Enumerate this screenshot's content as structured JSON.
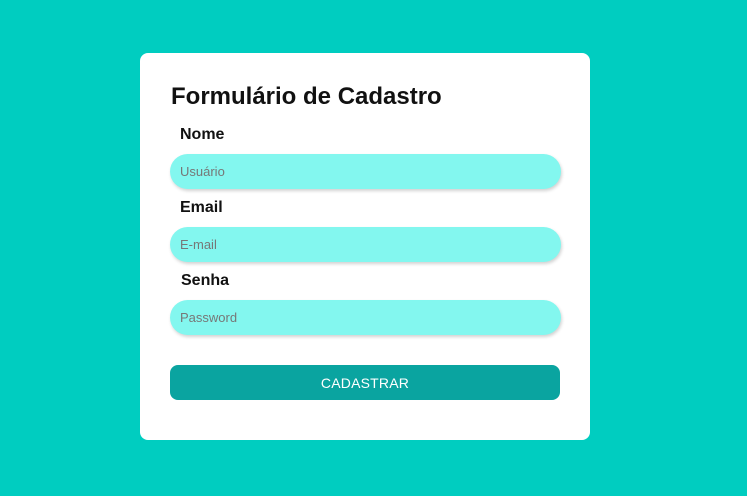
{
  "colors": {
    "background": "#00cdc0",
    "card": "#ffffff",
    "input_fill": "#83f7ef",
    "button": "#0aa4a0",
    "button_text": "#ffffff"
  },
  "form": {
    "title": "Formulário de Cadastro",
    "fields": [
      {
        "label": "Nome",
        "placeholder": "Usuário",
        "value": ""
      },
      {
        "label": "Email",
        "placeholder": "E-mail",
        "value": ""
      },
      {
        "label": "Senha",
        "placeholder": "Password",
        "value": ""
      }
    ],
    "submit_label": "CADASTRAR"
  }
}
